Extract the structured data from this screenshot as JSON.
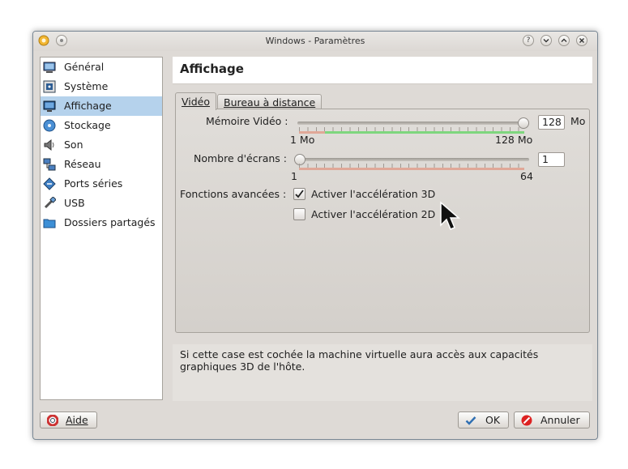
{
  "window": {
    "title": "Windows - Paramètres"
  },
  "sidebar": {
    "items": [
      {
        "label": "Général",
        "icon": "monitor-icon"
      },
      {
        "label": "Système",
        "icon": "chip-icon"
      },
      {
        "label": "Affichage",
        "icon": "display-icon",
        "selected": true
      },
      {
        "label": "Stockage",
        "icon": "disk-icon"
      },
      {
        "label": "Son",
        "icon": "speaker-icon"
      },
      {
        "label": "Réseau",
        "icon": "network-icon"
      },
      {
        "label": "Ports séries",
        "icon": "serial-port-icon"
      },
      {
        "label": "USB",
        "icon": "usb-icon"
      },
      {
        "label": "Dossiers partagés",
        "icon": "folder-icon"
      }
    ]
  },
  "page": {
    "title": "Affichage"
  },
  "tabs": [
    {
      "label": "Vidéo",
      "active": true
    },
    {
      "label": "Bureau à distance",
      "active": false
    }
  ],
  "video": {
    "memory_label": "Mémoire Vidéo :",
    "memory_value": "128",
    "memory_unit": "Mo",
    "memory_min_label": "1 Mo",
    "memory_max_label": "128 Mo",
    "memory_fraction": 1.0,
    "screens_label": "Nombre d'écrans :",
    "screens_value": "1",
    "screens_min_label": "1",
    "screens_max_label": "64",
    "screens_fraction": 0.0,
    "advanced_label": "Fonctions avancées :",
    "accel3d_label": "Activer l'accélération 3D",
    "accel3d_checked": true,
    "accel2d_label": "Activer l'accélération 2D",
    "accel2d_checked": false
  },
  "description": "Si cette case est cochée la machine virtuelle aura accès aux capacités graphiques 3D de l'hôte.",
  "buttons": {
    "help": "Aide",
    "ok": "OK",
    "cancel": "Annuler"
  },
  "colors": {
    "selection": "#b5d2ec",
    "scale_green": "#7ed67e",
    "scale_red": "#e0a898"
  }
}
